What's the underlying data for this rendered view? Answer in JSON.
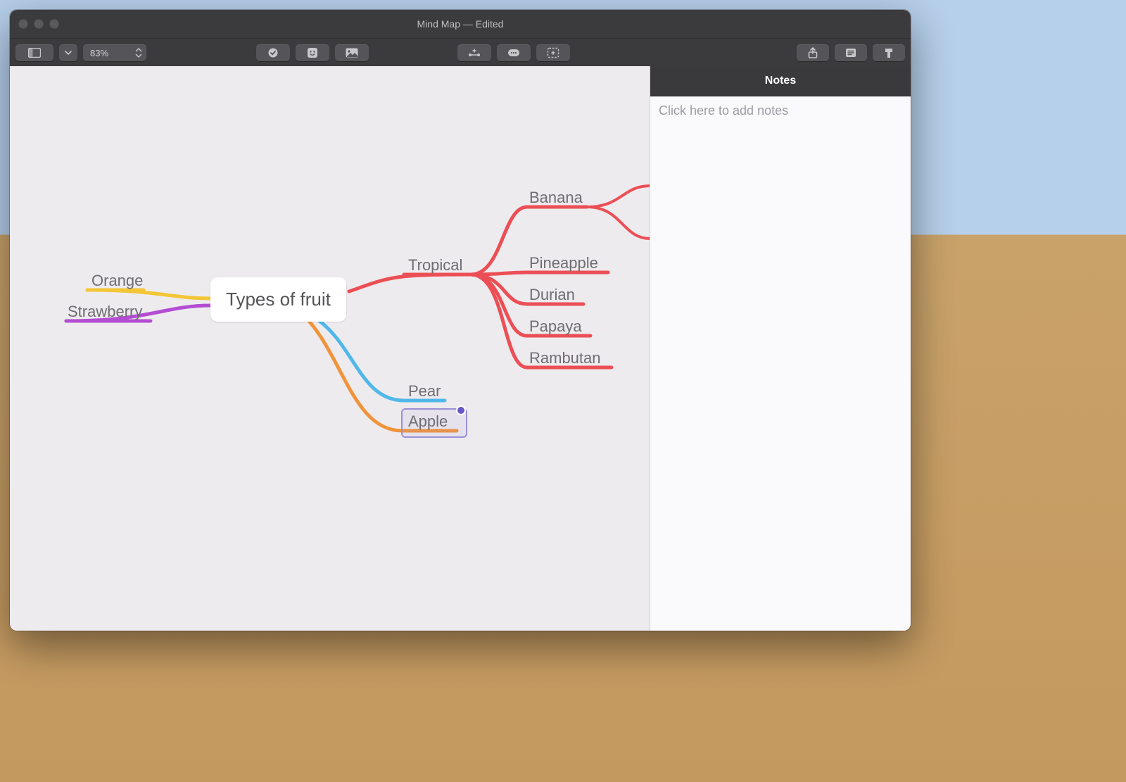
{
  "window": {
    "title": "Mind Map — Edited"
  },
  "toolbar": {
    "zoom": "83%"
  },
  "sidebar": {
    "header": "Notes",
    "notes_placeholder": "Click here to add notes"
  },
  "mindmap": {
    "central": {
      "label": "Types of fruit"
    },
    "left": [
      {
        "key": "orange",
        "label": "Orange",
        "color": "#f2c636"
      },
      {
        "key": "strawberry",
        "label": "Strawberry",
        "color": "#b34dd1"
      }
    ],
    "right": [
      {
        "key": "tropical",
        "label": "Tropical",
        "color": "#eb4f55",
        "children": [
          {
            "key": "banana",
            "label": "Banana"
          },
          {
            "key": "pineapple",
            "label": "Pineapple"
          },
          {
            "key": "durian",
            "label": "Durian"
          },
          {
            "key": "papaya",
            "label": "Papaya"
          },
          {
            "key": "rambutan",
            "label": "Rambutan"
          }
        ]
      },
      {
        "key": "pear",
        "label": "Pear",
        "color": "#4fb8e8"
      },
      {
        "key": "apple",
        "label": "Apple",
        "color": "#f0943b",
        "selected": true,
        "has_note": true
      }
    ]
  }
}
